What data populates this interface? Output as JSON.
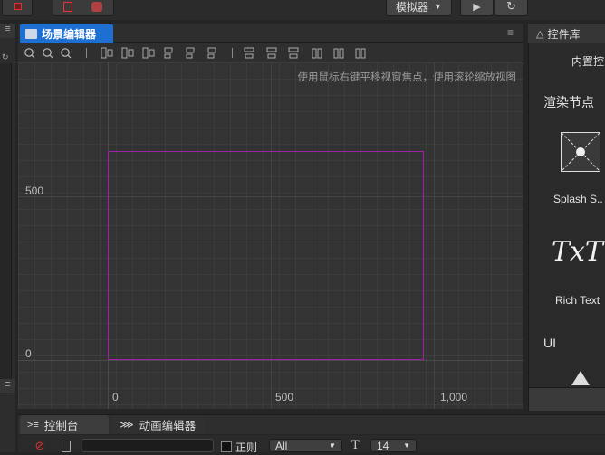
{
  "toolbar": {
    "simulator_label": "模拟器",
    "simulator_caret": "▼",
    "play_label": "▶",
    "refresh_label": "↻"
  },
  "scene_editor": {
    "tab_label": "场景编辑器",
    "menu_icon": "≡",
    "hint": "使用鼠标右键平移视窗焦点，使用滚轮缩放视图",
    "y_labels": [
      "500",
      "0"
    ],
    "x_labels": [
      "0",
      "500",
      "1,000"
    ]
  },
  "asset_panel": {
    "title": "控件库",
    "subtitle": "内置控",
    "section_render": "渲染节点",
    "items": [
      {
        "label": "Splash S..",
        "icon": "splash-sprite-icon"
      },
      {
        "label": "Rich Text",
        "icon": "rich-text-icon",
        "glyph": "TxT"
      }
    ],
    "section_ui": "UI"
  },
  "console": {
    "tab_console": "控制台",
    "tab_animation": "动画编辑器",
    "regex_label": "正则",
    "filter_value": "All",
    "font_size_value": "14",
    "search_value": ""
  },
  "colors": {
    "accent": "#1e6fd2",
    "design_rect": "#a020a8"
  }
}
